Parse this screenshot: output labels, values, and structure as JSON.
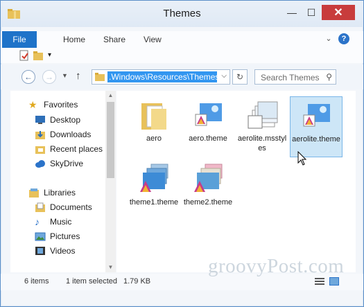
{
  "window": {
    "title": "Themes",
    "controls": {
      "minimize": "—",
      "maximize": "☐",
      "close": "✕"
    }
  },
  "ribbon": {
    "tabs": [
      {
        "label": "File"
      },
      {
        "label": "Home"
      },
      {
        "label": "Share"
      },
      {
        "label": "View"
      }
    ],
    "expand_icon": "chevron-down-icon",
    "help": "?"
  },
  "quick_access": {
    "dropdown": "▾"
  },
  "address_bar": {
    "path": ".Windows\\Resources\\Themes",
    "search_placeholder": "Search Themes"
  },
  "nav_pane": {
    "favorites": {
      "label": "Favorites",
      "items": [
        {
          "label": "Desktop"
        },
        {
          "label": "Downloads"
        },
        {
          "label": "Recent places"
        },
        {
          "label": "SkyDrive"
        }
      ]
    },
    "libraries": {
      "label": "Libraries",
      "items": [
        {
          "label": "Documents"
        },
        {
          "label": "Music"
        },
        {
          "label": "Pictures"
        },
        {
          "label": "Videos"
        }
      ]
    }
  },
  "files": [
    {
      "label": "aero",
      "type": "folder"
    },
    {
      "label": "aero.theme",
      "type": "theme"
    },
    {
      "label": "aerolite.msstyles",
      "type": "msstyles"
    },
    {
      "label": "aerolite.theme",
      "type": "theme",
      "selected": true
    },
    {
      "label": "theme1.theme",
      "type": "theme-gallery"
    },
    {
      "label": "theme2.theme",
      "type": "theme-gallery"
    }
  ],
  "status": {
    "item_count": "6 items",
    "selected": "1 item selected",
    "size": "1.79 KB"
  },
  "watermark": "groovyPost.com",
  "colors": {
    "accent": "#1e73c9",
    "selection": "#cde6f7",
    "close_button": "#c83c3c"
  }
}
